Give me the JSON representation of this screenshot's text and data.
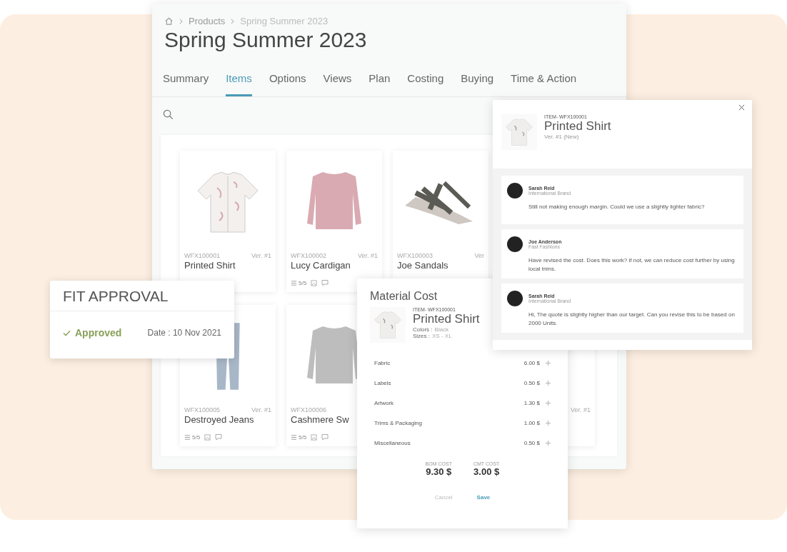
{
  "breadcrumb": [
    "Products",
    "Spring Summer 2023"
  ],
  "title": "Spring Summer 2023",
  "tabs": [
    {
      "label": "Summary",
      "selected": false
    },
    {
      "label": "Items",
      "selected": true
    },
    {
      "label": "Options",
      "selected": false
    },
    {
      "label": "Views",
      "selected": false
    },
    {
      "label": "Plan",
      "selected": false
    },
    {
      "label": "Costing",
      "selected": false
    },
    {
      "label": "Buying",
      "selected": false
    },
    {
      "label": "Time & Action",
      "selected": false
    }
  ],
  "card_rows": [
    [
      {
        "kind": "shirt",
        "id": "WFX100001",
        "version": "Ver. #1",
        "name": "Printed Shirt"
      },
      {
        "kind": "pinksweater",
        "id": "WFX100002",
        "version": "Ver. #1",
        "name": "Lucy Cardigan",
        "stats": "5/5"
      },
      {
        "kind": "sandals",
        "id": "WFX100003",
        "version": "Ver",
        "name": "Joe Sandals"
      }
    ],
    [
      {
        "kind": "jeans",
        "id": "WFX100005",
        "version": "Ver. #1",
        "name": "Destroyed Jeans",
        "stats": "5/5"
      },
      {
        "kind": "graysweater",
        "id": "WFX100006",
        "name": "Cashmere Sw",
        "stats": "5/5"
      },
      {
        "version": "Ver. #1"
      }
    ]
  ],
  "comments_panel": {
    "item_code": "ITEM- WFX100001",
    "name": "Printed Shirt",
    "version": "Ver. #1 (New)",
    "comments": [
      {
        "author": "Sarah Reid",
        "org": "International Brand",
        "text": "Still not making enough margin. Could we use a slightly lighter fabric?"
      },
      {
        "author": "Joe Anderson",
        "org": "Fast Fashions",
        "text": "Have revised the cost. Does this work? if not, we can reduce cost further by using local trims."
      },
      {
        "author": "Sarah Reid",
        "org": "International Brand",
        "text": "Hi, The quote is slightly higher than our target. Can you revise this to be based on 2000 Units."
      }
    ]
  },
  "material_cost": {
    "title": "Material Cost",
    "item_code": "ITEM- WFX100001",
    "name": "Printed Shirt",
    "attributes": [
      {
        "label": "Colors :",
        "value": "Black"
      },
      {
        "label": "Sizes :",
        "value": "XS - XL"
      }
    ],
    "lines": [
      {
        "name": "Fabric",
        "amount": "6.00 $"
      },
      {
        "name": "Labels",
        "amount": "0.50 $"
      },
      {
        "name": "Artwork",
        "amount": "1.30 $"
      },
      {
        "name": "Trims & Packaging",
        "amount": "1.00 $"
      },
      {
        "name": "Miscellaneous",
        "amount": "0.50 $"
      }
    ],
    "totals": [
      {
        "label": "BOM COST",
        "value": "9.30 $"
      },
      {
        "label": "CMT COST",
        "value": "3.00 $"
      }
    ],
    "buttons": [
      {
        "label": "Cancel",
        "kind": "secondary"
      },
      {
        "label": "Save",
        "kind": "primary"
      }
    ]
  },
  "fit_approval": {
    "title": "FIT APPROVAL",
    "status": "Approved",
    "date": "Date : 10 Nov 2021"
  }
}
